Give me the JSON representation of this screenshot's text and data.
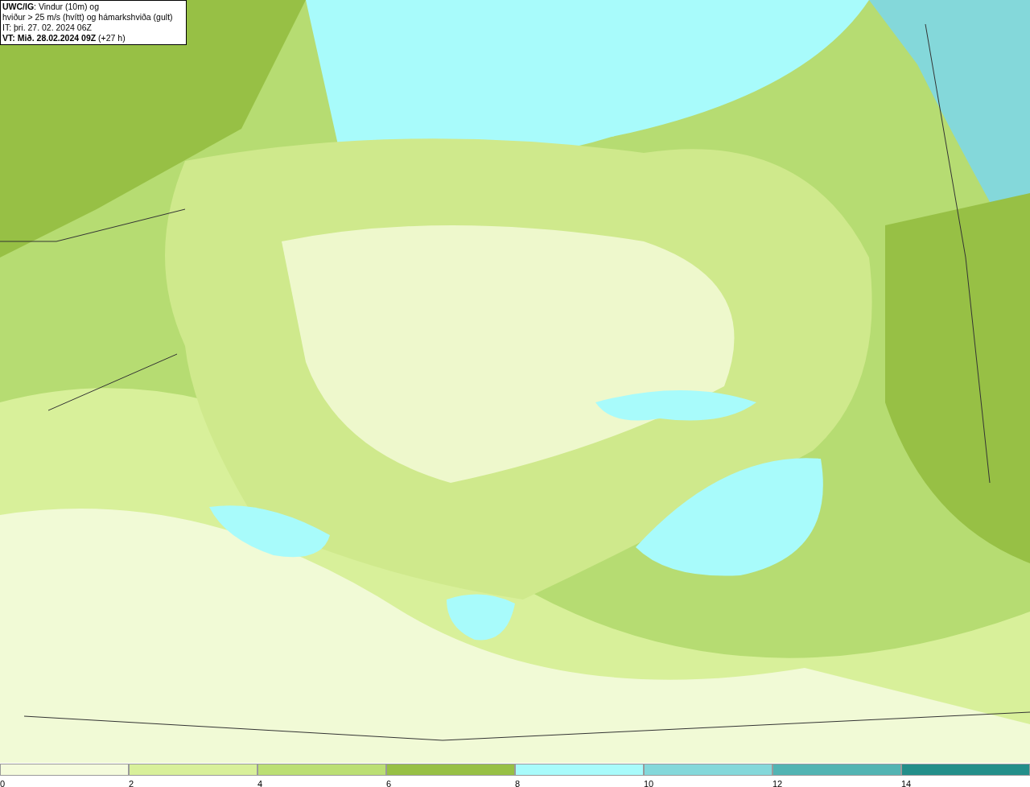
{
  "title_box": {
    "lines": [
      "**UWC/IG**: Vindur (10m) og",
      "hviður > 25 m/s (hvítt) og hámarkshviða (gult)",
      "IT: þri. 27. 02. 2024 06Z",
      "**VT: Mið. 28.02.2024 09Z** (+27 h)"
    ]
  },
  "legend": {
    "segments": [
      {
        "color": "#f4fbdc",
        "label": "0"
      },
      {
        "color": "#d8f09a",
        "label": "2"
      },
      {
        "color": "#bbdf74",
        "label": "4"
      },
      {
        "color": "#97c045",
        "label": "6"
      },
      {
        "color": "#a8fbfb",
        "label": "8"
      },
      {
        "color": "#84d8da",
        "label": "10"
      },
      {
        "color": "#52b4b3",
        "label": "12"
      },
      {
        "color": "#238f8a",
        "label": "14"
      }
    ]
  }
}
